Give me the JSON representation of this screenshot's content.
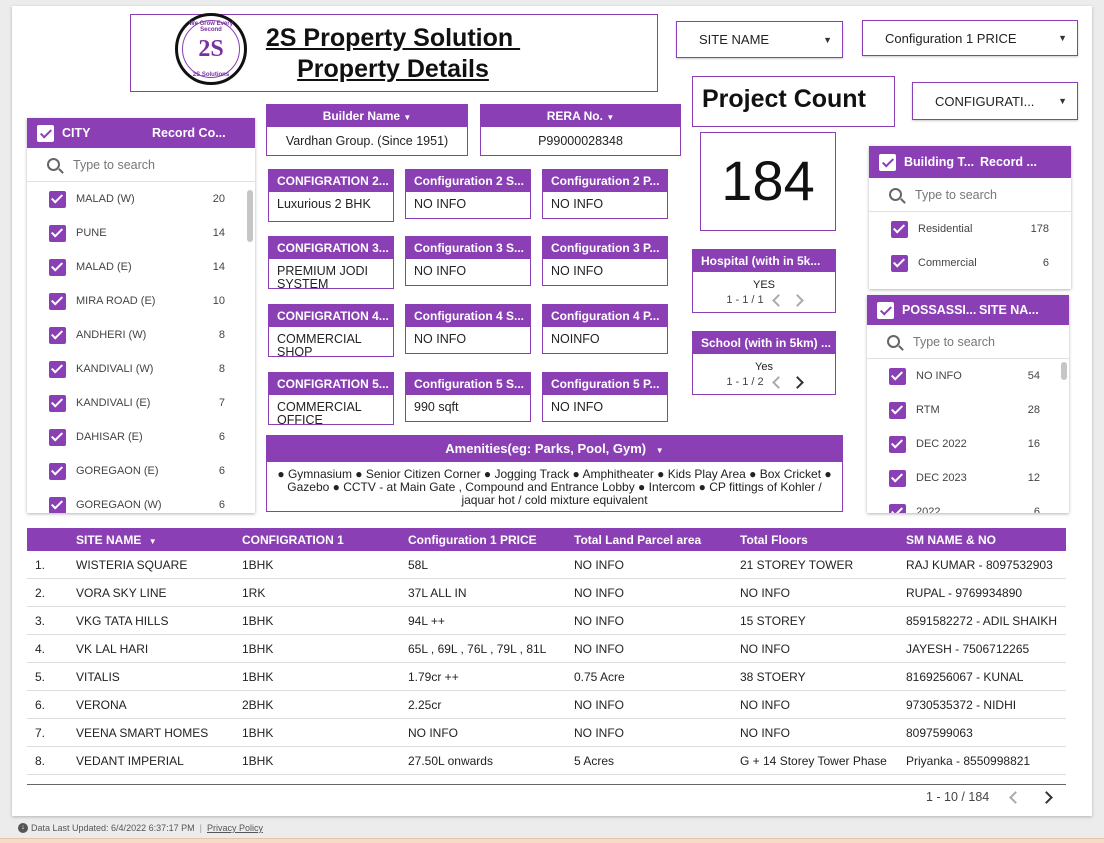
{
  "header": {
    "title_line1": "2S Property Solution ",
    "title_line2": "Property Details",
    "logo_top": "We Grow Every Second",
    "logo_mark": "2S",
    "logo_bottom": "2S Solutions"
  },
  "controls": {
    "site_name": "SITE NAME",
    "config1_price": "Configuration 1 PRICE",
    "configuration": "CONFIGURATI..."
  },
  "project_count": {
    "label": "Project Count",
    "value": "184"
  },
  "city_filter": {
    "header": "CITY",
    "count_header": "Record Co...",
    "search_placeholder": "Type to search",
    "items": [
      {
        "label": "MALAD (W)",
        "count": "20"
      },
      {
        "label": "PUNE",
        "count": "14"
      },
      {
        "label": "MALAD (E)",
        "count": "14"
      },
      {
        "label": "MIRA ROAD (E)",
        "count": "10"
      },
      {
        "label": "ANDHERI (W)",
        "count": "8"
      },
      {
        "label": "KANDIVALI (W)",
        "count": "8"
      },
      {
        "label": "KANDIVALI (E)",
        "count": "7"
      },
      {
        "label": "DAHISAR (E)",
        "count": "6"
      },
      {
        "label": "GOREGAON (E)",
        "count": "6"
      },
      {
        "label": "GOREGAON (W)",
        "count": "6"
      }
    ]
  },
  "builder": {
    "header": "Builder Name",
    "value": "Vardhan Group. (Since 1951)"
  },
  "rera": {
    "header": "RERA No.",
    "value": "P99000028348"
  },
  "configs": [
    {
      "h1": "CONFIGRATION 2...",
      "v1": "Luxurious 2 BHK",
      "h2": "Configuration 2 S...",
      "v2": "NO INFO",
      "h3": "Configuration 2 P...",
      "v3": "NO INFO"
    },
    {
      "h1": "CONFIGRATION 3...",
      "v1": "PREMIUM JODI SYSTEM",
      "h2": "Configuration 3 S...",
      "v2": "NO INFO",
      "h3": "Configuration 3 P...",
      "v3": "NO INFO"
    },
    {
      "h1": "CONFIGRATION 4...",
      "v1": "COMMERCIAL SHOP",
      "h2": "Configuration 4 S...",
      "v2": "NO INFO",
      "h3": "Configuration 4 P...",
      "v3": "NOINFO"
    },
    {
      "h1": "CONFIGRATION 5...",
      "v1": "COMMERCIAL OFFICE",
      "h2": "Configuration 5 S...",
      "v2": "990 sqft",
      "h3": "Configuration 5 P...",
      "v3": "NO INFO"
    }
  ],
  "hospital": {
    "header": "Hospital (with in 5k...",
    "value": "YES",
    "pager": "1 - 1 / 1"
  },
  "school": {
    "header": "School (with in 5km) ...",
    "value": "Yes",
    "pager": "1 - 1 / 2"
  },
  "amenities": {
    "header": "Amenities(eg: Parks, Pool, Gym)",
    "text": "● Gymnasium ● Senior Citizen Corner ● Jogging Track ● Amphitheater ● Kids Play Area ● Box Cricket ● Gazebo ● CCTV - at Main Gate , Compound and Entrance Lobby ● Intercom ● CP fittings of Kohler / jaquar hot / cold mixture equivalent"
  },
  "building_filter": {
    "header": "Building T...",
    "count_header": "Record ...",
    "search_placeholder": "Type to search",
    "items": [
      {
        "label": "Residential",
        "count": "178"
      },
      {
        "label": "Commercial",
        "count": "6"
      }
    ]
  },
  "possession_filter": {
    "header": "POSSASSI...",
    "count_header": "SITE NA...",
    "search_placeholder": "Type to search",
    "items": [
      {
        "label": "NO INFO",
        "count": "54"
      },
      {
        "label": "RTM",
        "count": "28"
      },
      {
        "label": "DEC 2022",
        "count": "16"
      },
      {
        "label": "DEC 2023",
        "count": "12"
      },
      {
        "label": "2022",
        "count": "6"
      }
    ]
  },
  "table": {
    "columns": [
      "SITE NAME",
      "CONFIGRATION 1",
      "Configuration 1 PRICE",
      "Total Land Parcel area",
      "Total Floors",
      "SM NAME & NO"
    ],
    "rows": [
      [
        "1.",
        "WISTERIA SQUARE",
        "1BHK",
        "58L",
        "NO INFO",
        "21 STOREY TOWER",
        "RAJ KUMAR - 8097532903"
      ],
      [
        "2.",
        "VORA SKY LINE",
        "1RK",
        "37L ALL IN",
        "NO INFO",
        "NO INFO",
        "RUPAL - 9769934890"
      ],
      [
        "3.",
        "VKG TATA HILLS",
        "1BHK",
        "94L ++",
        "NO INFO",
        "15 STOREY",
        "8591582272 - ADIL SHAIKH"
      ],
      [
        "4.",
        "VK LAL HARI",
        "1BHK",
        "65L , 69L , 76L , 79L , 81L",
        "NO INFO",
        "NO INFO",
        "JAYESH - 7506712265"
      ],
      [
        "5.",
        "VITALIS",
        "1BHK",
        "1.79cr ++",
        "0.75 Acre",
        "38 STOERY",
        "8169256067 - KUNAL"
      ],
      [
        "6.",
        "VERONA",
        "2BHK",
        "2.25cr",
        "NO INFO",
        "NO INFO",
        "9730535372 - NIDHI"
      ],
      [
        "7.",
        "VEENA SMART HOMES",
        "1BHK",
        "NO INFO",
        "NO INFO",
        "NO INFO",
        "8097599063"
      ],
      [
        "8.",
        "VEDANT IMPERIAL",
        "1BHK",
        "27.50L onwards",
        "5 Acres",
        "G + 14 Storey Tower Phase",
        "Priyanka - 8550998821"
      ]
    ],
    "pager": "1 - 10 / 184"
  },
  "footer": {
    "updated": "Data Last Updated: 6/4/2022 6:37:17 PM",
    "privacy": "Privacy Policy"
  }
}
